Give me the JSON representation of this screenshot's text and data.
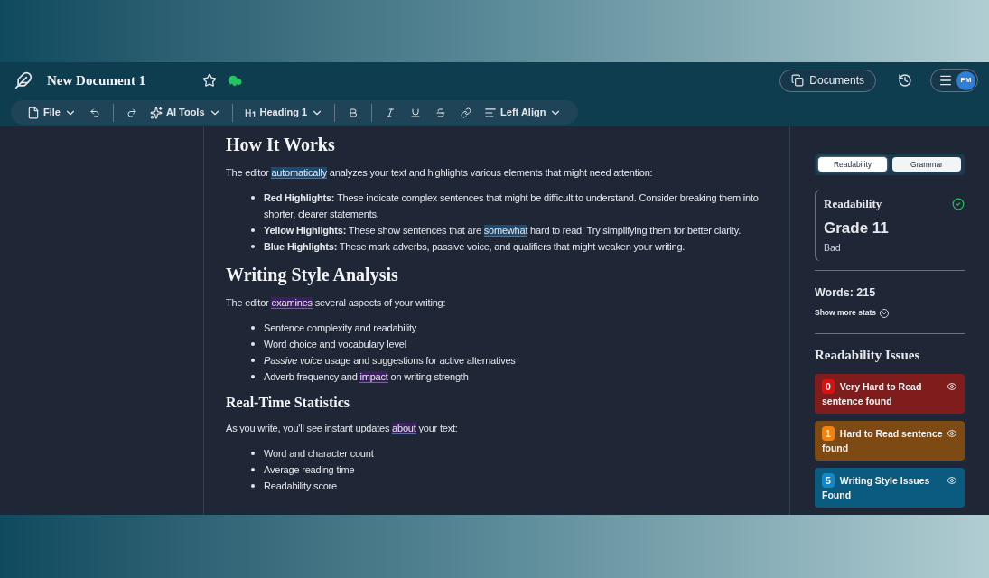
{
  "header": {
    "title": "New Document 1",
    "documents_button": "Documents",
    "avatar": "PM"
  },
  "toolbar": [
    {
      "kind": "menu",
      "label": "File"
    },
    {
      "kind": "icon"
    },
    {
      "kind": "icon"
    },
    {
      "kind": "menu",
      "label": "AI Tools"
    },
    {
      "kind": "menu",
      "label": "Heading 1"
    },
    {
      "kind": "icon"
    },
    {
      "kind": "icon"
    },
    {
      "kind": "icon"
    },
    {
      "kind": "icon"
    },
    {
      "kind": "icon"
    },
    {
      "kind": "menu",
      "label": "Left Align"
    }
  ],
  "document": [
    {
      "kind": "h1",
      "segments": [
        {
          "text": "How It Works"
        }
      ]
    },
    {
      "kind": "p",
      "segments": [
        {
          "text": "The editor "
        },
        {
          "text": "automatically",
          "color": "#1d4a6e"
        },
        {
          "text": " analyzes your text and highlights various elements that might need attention:"
        }
      ]
    },
    {
      "kind": "ul",
      "items": [
        {
          "segments": [
            {
              "text": "**Red Highlights:** These indicate complex sentences that might be difficult to understand. Consider breaking them into shorter, clearer statements."
            }
          ]
        },
        {
          "segments": [
            {
              "text": "**Yellow Highlights:** These show sentences that are "
            },
            {
              "text": "somewhat",
              "color": "#1d4a6e"
            },
            {
              "text": " hard to read. Try simplifying them for better clarity."
            }
          ]
        },
        {
          "segments": [
            {
              "text": "**Blue Highlights:** These mark adverbs, passive voice, and qualifiers that might weaken your writing."
            }
          ]
        }
      ]
    },
    {
      "kind": "h1",
      "segments": [
        {
          "text": "Writing Style Analysis"
        }
      ]
    },
    {
      "kind": "p",
      "segments": [
        {
          "text": "The editor "
        },
        {
          "text": "examines",
          "color": "#3b1f5e"
        },
        {
          "text": " several aspects of your writing:"
        }
      ]
    },
    {
      "kind": "ul",
      "items": [
        {
          "segments": [
            {
              "text": "Sentence complexity and readability"
            }
          ]
        },
        {
          "segments": [
            {
              "text": "Word choice and vocabulary level"
            }
          ]
        },
        {
          "segments": [
            {
              "text": "*Passive voice* usage and suggestions for active alternatives"
            }
          ]
        },
        {
          "segments": [
            {
              "text": "Adverb frequency and "
            },
            {
              "text": "impact",
              "color": "#3b1f5e"
            },
            {
              "text": " on writing strength"
            }
          ]
        }
      ]
    },
    {
      "kind": "h2",
      "segments": [
        {
          "text": "Real-Time Statistics"
        }
      ]
    },
    {
      "kind": "p",
      "segments": [
        {
          "text": "As you write, you'll see instant updates "
        },
        {
          "text": "about",
          "color": "#3b1f5e"
        },
        {
          "text": " your text:"
        }
      ]
    },
    {
      "kind": "ul",
      "items": [
        {
          "segments": [
            {
              "text": "Word and character count"
            }
          ]
        },
        {
          "segments": [
            {
              "text": "Average reading time"
            }
          ]
        },
        {
          "segments": [
            {
              "text": "Readability score"
            }
          ]
        }
      ]
    }
  ],
  "sidebar": {
    "tabs": [
      {
        "label": "Readability",
        "selected": true
      },
      {
        "label": "Grammar",
        "selected": false
      }
    ],
    "score": {
      "title": "Readability",
      "grade": "Grade 11",
      "verdict": "Bad"
    },
    "words": "Words: 215",
    "more_stats": "Show more stats",
    "issues_title": "Readability Issues",
    "issues": [
      {
        "count": "0",
        "label": "Very Hard to Read sentence found",
        "color": "#7f1d1d"
      },
      {
        "count": "1",
        "label": "Hard to Read sentence found",
        "color": "#7c4a12"
      },
      {
        "count": "5",
        "label": "Writing Style Issues Found",
        "color": "#0b5a80"
      }
    ]
  }
}
